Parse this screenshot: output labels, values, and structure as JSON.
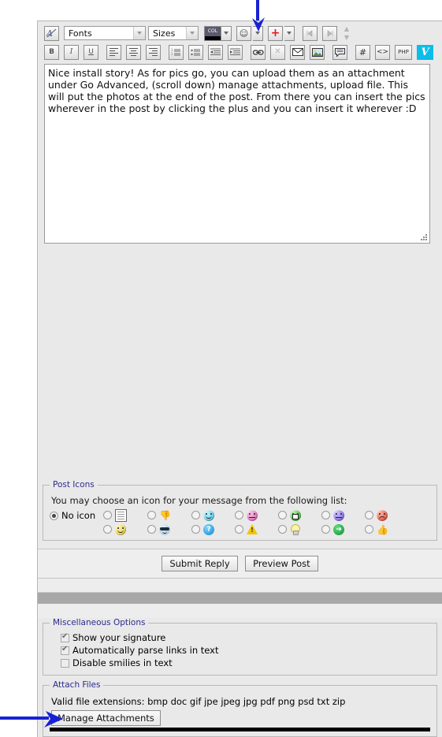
{
  "editor": {
    "toolbar": {
      "font_select": {
        "label": "Fonts",
        "icon": "font-style-icon"
      },
      "size_select": {
        "label": "Sizes"
      },
      "color_button": {
        "label": "COL",
        "icon": "text-color-icon"
      },
      "smiley_button": {
        "icon": "smiley-icon"
      },
      "plus_button": {
        "label": "+",
        "icon": "insert-attachment-plus-icon",
        "color": "#e01b1b"
      },
      "undo_button": {
        "icon": "undo-icon"
      },
      "redo_button": {
        "icon": "redo-icon"
      },
      "scroll_up": {
        "icon": "scroll-up-icon"
      },
      "scroll_down": {
        "icon": "scroll-down-icon"
      },
      "bold": {
        "label": "B",
        "icon": "bold-icon"
      },
      "italic": {
        "label": "I",
        "icon": "italic-icon"
      },
      "underline": {
        "label": "U",
        "icon": "underline-icon"
      },
      "align_left": {
        "icon": "align-left-icon"
      },
      "align_center": {
        "icon": "align-center-icon"
      },
      "align_right": {
        "icon": "align-right-icon"
      },
      "list_ordered": {
        "icon": "ordered-list-icon"
      },
      "list_bullet": {
        "icon": "bullet-list-icon"
      },
      "outdent": {
        "icon": "outdent-icon"
      },
      "indent": {
        "icon": "indent-icon"
      },
      "link": {
        "icon": "link-icon"
      },
      "unlink": {
        "icon": "unlink-icon"
      },
      "email": {
        "icon": "email-icon"
      },
      "image": {
        "icon": "insert-image-icon"
      },
      "quote": {
        "icon": "quote-icon"
      },
      "code_hash": {
        "label": "#",
        "icon": "code-icon"
      },
      "html_tag": {
        "label": "<>",
        "icon": "html-icon"
      },
      "php": {
        "label": "PHP",
        "icon": "php-icon"
      },
      "vimeo": {
        "label": "V",
        "icon": "vimeo-icon",
        "color": "#0bbde8"
      }
    },
    "message_text": "Nice install story! As for pics go, you can upload them as an attachment under Go Advanced, (scroll down) manage attachments, upload file. This will put the photos at the end of the post. From there you can insert the pics wherever in the post by clicking the plus and you can insert it wherever :D"
  },
  "post_icons": {
    "legend": "Post Icons",
    "hint": "You may choose an icon for your message from the following list:",
    "no_icon_label": "No icon",
    "no_icon_selected": true,
    "columns": [
      {
        "top": {
          "name": "document-icon"
        },
        "bottom": {
          "name": "smile-yellow-icon"
        }
      },
      {
        "top": {
          "name": "thumbs-down-icon"
        },
        "bottom": {
          "name": "cool-shades-icon"
        }
      },
      {
        "top": {
          "name": "smile-cyan-icon"
        },
        "bottom": {
          "name": "question-blue-icon"
        }
      },
      {
        "top": {
          "name": "smile-pink-icon"
        },
        "bottom": {
          "name": "warning-triangle-icon"
        }
      },
      {
        "top": {
          "name": "grin-green-icon"
        },
        "bottom": {
          "name": "lightbulb-icon"
        }
      },
      {
        "top": {
          "name": "frown-purple-icon"
        },
        "bottom": {
          "name": "arrow-green-icon"
        }
      },
      {
        "top": {
          "name": "angry-red-icon"
        },
        "bottom": {
          "name": "thumbs-up-icon"
        }
      }
    ]
  },
  "actions": {
    "submit_label": "Submit Reply",
    "preview_label": "Preview Post"
  },
  "misc_options": {
    "legend": "Miscellaneous Options",
    "items": [
      {
        "label": "Show your signature",
        "checked": true
      },
      {
        "label": "Automatically parse links in text",
        "checked": true
      },
      {
        "label": "Disable smilies in text",
        "checked": false
      }
    ]
  },
  "attach_files": {
    "legend": "Attach Files",
    "extensions_text": "Valid file extensions: bmp doc gif jpe jpeg jpg pdf png psd txt zip",
    "manage_label": "Manage Attachments"
  },
  "annotations": {
    "color": "#1822d4",
    "arrows": [
      {
        "name": "arrow-pointing-to-plus-button",
        "direction": "down"
      },
      {
        "name": "arrow-pointing-to-manage-attachments",
        "direction": "right"
      }
    ]
  }
}
